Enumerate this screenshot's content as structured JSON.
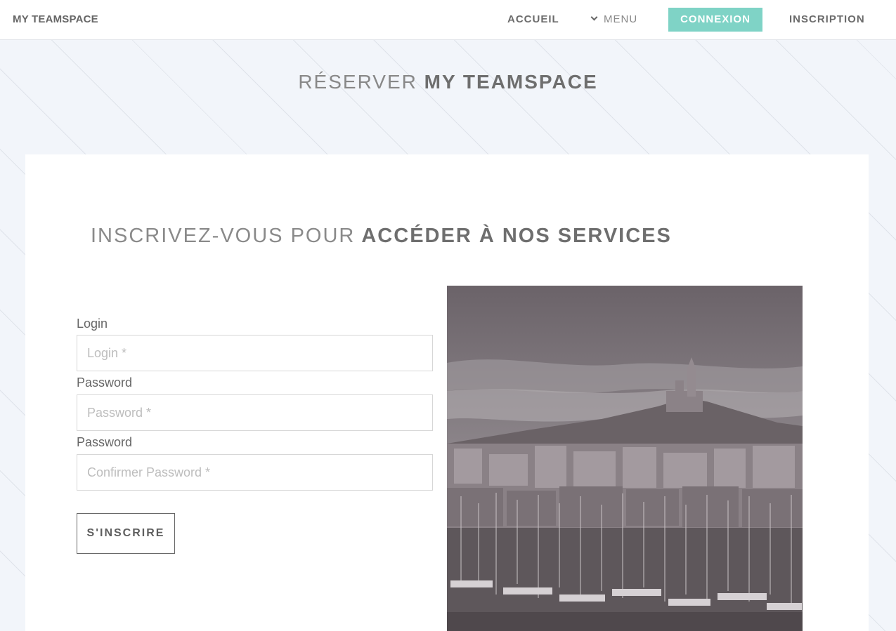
{
  "header": {
    "brand": "MY TEAMSPACE",
    "nav": {
      "accueil": "ACCUEIL",
      "menu": "MENU",
      "connexion": "CONNEXION",
      "inscription": "INSCRIPTION"
    },
    "menu_icon": "chevron-down-icon",
    "accent_color": "#7fd3c6"
  },
  "hero": {
    "title_light": "RÉSERVER",
    "title_strong": "MY TEAMSPACE"
  },
  "signup": {
    "title_light": "INSCRIVEZ-VOUS POUR",
    "title_strong": "ACCÉDER À NOS SERVICES",
    "login": {
      "label": "Login",
      "placeholder": "Login *",
      "value": ""
    },
    "password": {
      "label": "Password",
      "placeholder": "Password *",
      "value": ""
    },
    "confirm": {
      "label": "Password",
      "placeholder": "Confirmer Password *",
      "value": ""
    },
    "submit_label": "S'INSCRIRE"
  },
  "photo": {
    "subject": "harbor-city-photo"
  }
}
